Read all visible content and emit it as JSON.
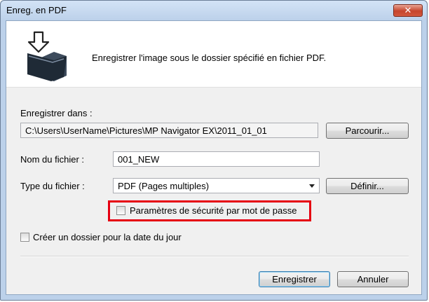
{
  "window": {
    "title": "Enreg. en PDF",
    "close_icon": "close-icon"
  },
  "header": {
    "description": "Enregistrer l'image sous le dossier spécifié en fichier PDF."
  },
  "save_in": {
    "label": "Enregistrer dans :",
    "value": "C:\\Users\\UserName\\Pictures\\MP Navigator EX\\2011_01_01",
    "browse_label": "Parcourir..."
  },
  "file_name": {
    "label": "Nom du fichier :",
    "value": "001_NEW"
  },
  "file_type": {
    "label": "Type du fichier :",
    "selected": "PDF (Pages multiples)",
    "settings_label": "Définir..."
  },
  "password_security": {
    "label": "Paramètres de sécurité par mot de passe",
    "checked": false,
    "highlight_color": "#e60012"
  },
  "date_folder": {
    "label": "Créer un dossier pour la date du jour",
    "checked": false
  },
  "footer": {
    "save_label": "Enregistrer",
    "cancel_label": "Annuler"
  }
}
